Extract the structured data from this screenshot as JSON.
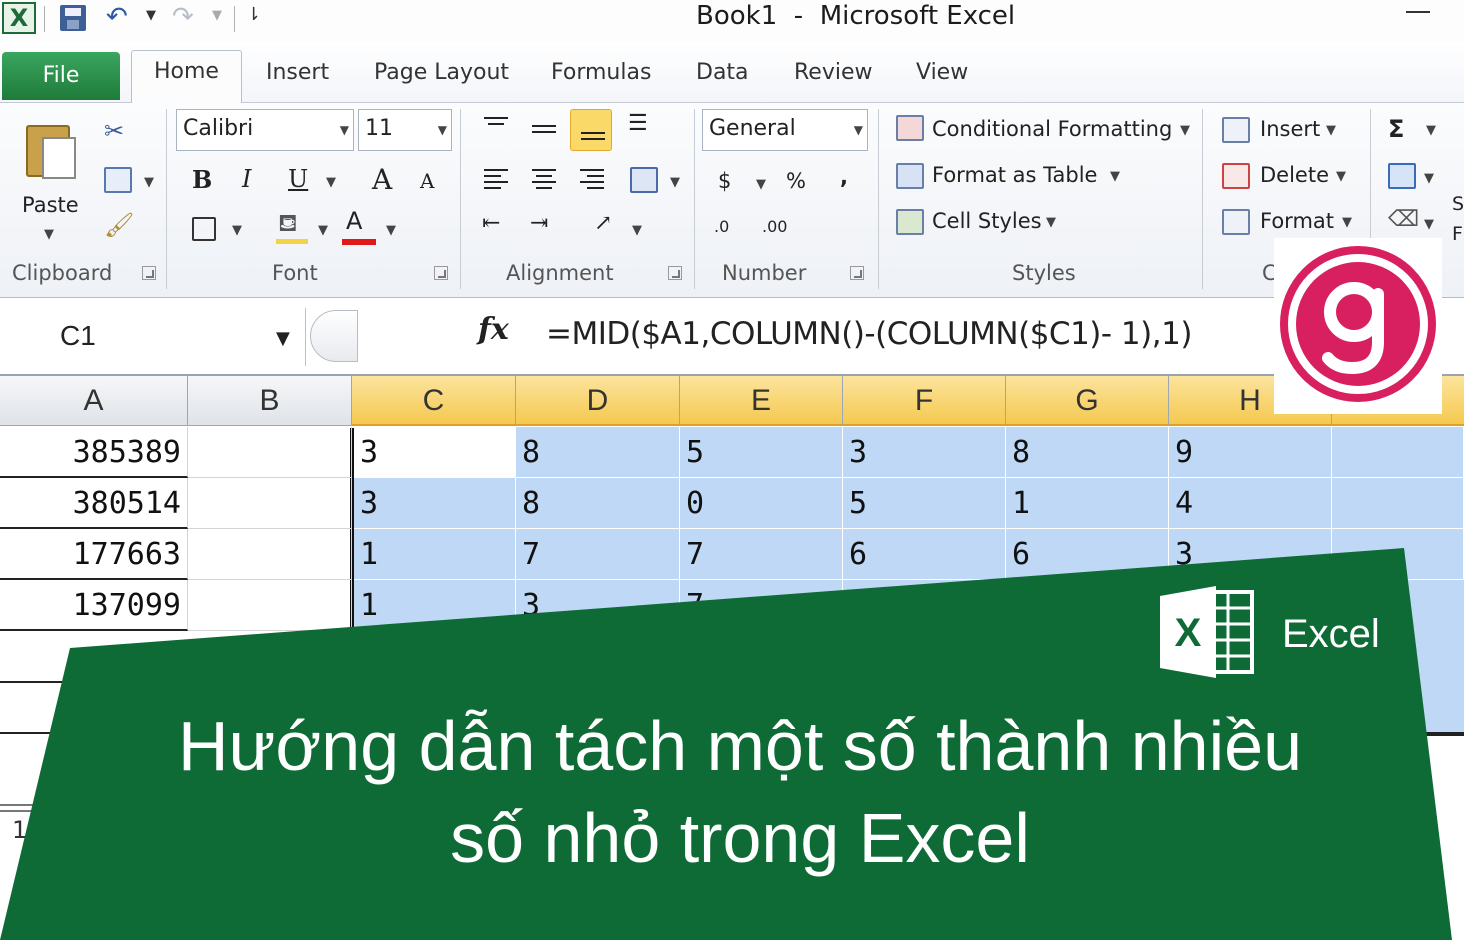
{
  "window": {
    "title": "Book1  -  Microsoft Excel"
  },
  "qat": {
    "app_icon_letter": "X"
  },
  "tabs": {
    "file": "File",
    "items": [
      "Home",
      "Insert",
      "Page Layout",
      "Formulas",
      "Data",
      "Review",
      "View"
    ]
  },
  "ribbon": {
    "clipboard": {
      "paste": "Paste",
      "label": "Clipboard"
    },
    "font": {
      "name": "Calibri",
      "size": "11",
      "label": "Font",
      "bold": "B",
      "italic": "I",
      "underline": "U",
      "grow": "A",
      "shrink": "A",
      "font_color": "A"
    },
    "alignment": {
      "label": "Alignment"
    },
    "number": {
      "format": "General",
      "currency": "$",
      "percent": "%",
      "comma": ",",
      "inc_decimal": ".0",
      "dec_decimal": ".00",
      "label": "Number"
    },
    "styles": {
      "conditional": "Conditional Formatting",
      "format_table": "Format as Table",
      "cell_styles": "Cell Styles",
      "label": "Styles"
    },
    "cells": {
      "insert": "Insert",
      "delete": "Delete",
      "format": "Format",
      "label": "C"
    },
    "editing": {
      "sum": "Σ",
      "partial_1": "S",
      "partial_2": "F"
    }
  },
  "formula_bar": {
    "name_box": "C1",
    "fx": "fx",
    "formula": "=MID($A1,COLUMN()-(COLUMN($C1)- 1),1)"
  },
  "grid": {
    "columns": [
      "A",
      "B",
      "C",
      "D",
      "E",
      "F",
      "G",
      "H"
    ],
    "rows": [
      {
        "a": "385389",
        "digits": [
          "3",
          "8",
          "5",
          "3",
          "8",
          "9"
        ]
      },
      {
        "a": "380514",
        "digits": [
          "3",
          "8",
          "0",
          "5",
          "1",
          "4"
        ]
      },
      {
        "a": "177663",
        "digits": [
          "1",
          "7",
          "7",
          "6",
          "6",
          "3"
        ]
      },
      {
        "a": "137099",
        "digits": [
          "1",
          "3",
          "7"
        ]
      }
    ],
    "row_number_partial": "1"
  },
  "banner": {
    "line1": "Hướng dẫn tách một số thành nhiều",
    "line2": "số nhỏ trong Excel",
    "brand_letter": "X",
    "brand_word": "Excel"
  },
  "colors": {
    "banner_green": "#0e6b35",
    "selection_blue": "#bed8f6",
    "header_gold": "#f5c94f",
    "logo_pink": "#d81f5f",
    "file_green": "#2a8a47"
  }
}
